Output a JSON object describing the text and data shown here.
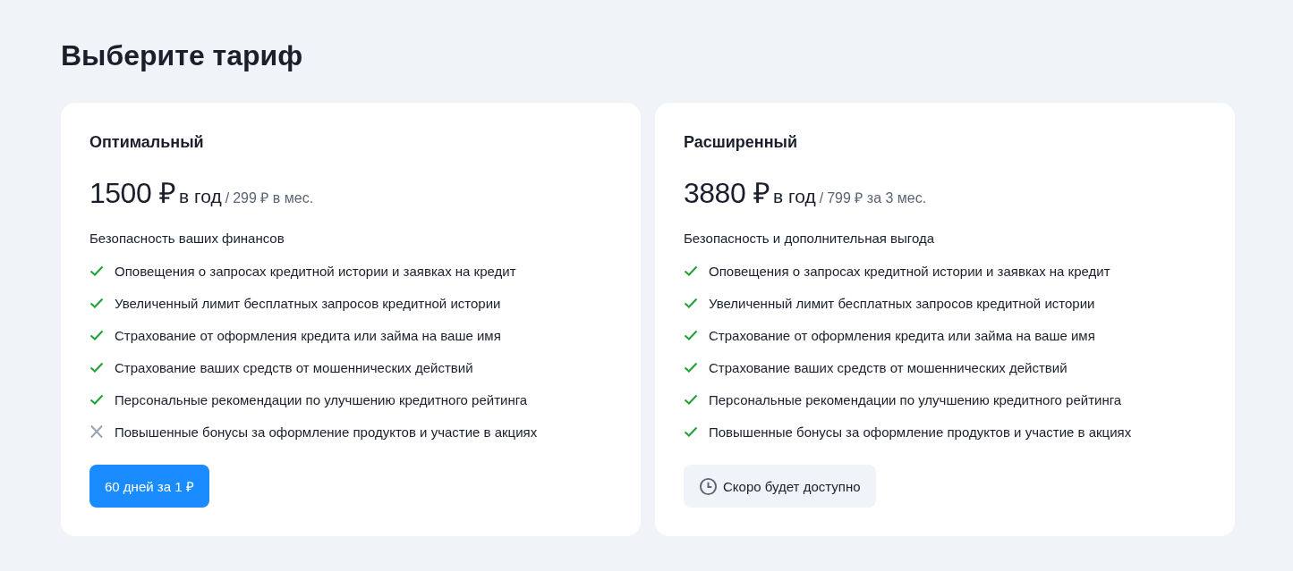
{
  "title": "Выберите тариф",
  "plans": [
    {
      "name": "Оптимальный",
      "price": "1500 ₽",
      "period": "в год",
      "separator": "/",
      "alt_price": "299 ₽ в мес.",
      "subtitle": "Безопасность ваших финансов",
      "features": [
        {
          "text": "Оповещения о запросах кредитной истории и заявках на кредит",
          "included": true
        },
        {
          "text": "Увеличенный лимит бесплатных запросов кредитной истории",
          "included": true
        },
        {
          "text": "Страхование от оформления кредита или займа на ваше имя",
          "included": true
        },
        {
          "text": "Страхование ваших средств от мошеннических действий",
          "included": true
        },
        {
          "text": "Персональные рекомендации по улучшению кредитного рейтинга",
          "included": true
        },
        {
          "text": "Повышенные бонусы за оформление продуктов и участие в акциях",
          "included": false
        }
      ],
      "action": {
        "kind": "button",
        "label": "60 дней за 1 ₽"
      }
    },
    {
      "name": "Расширенный",
      "price": "3880 ₽",
      "period": "в год",
      "separator": "/",
      "alt_price": "799 ₽ за 3 мес.",
      "subtitle": "Безопасность и дополнительная выгода",
      "features": [
        {
          "text": "Оповещения о запросах кредитной истории и заявках на кредит",
          "included": true
        },
        {
          "text": "Увеличенный лимит бесплатных запросов кредитной истории",
          "included": true
        },
        {
          "text": "Страхование от оформления кредита или займа на ваше имя",
          "included": true
        },
        {
          "text": "Страхование ваших средств от мошеннических действий",
          "included": true
        },
        {
          "text": "Персональные рекомендации по улучшению кредитного рейтинга",
          "included": true
        },
        {
          "text": "Повышенные бонусы за оформление продуктов и участие в акциях",
          "included": true
        }
      ],
      "action": {
        "kind": "soon",
        "label": "Скоро будет доступно"
      }
    }
  ]
}
